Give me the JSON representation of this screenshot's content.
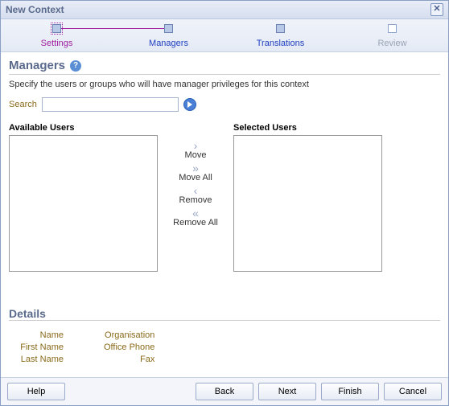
{
  "dialog": {
    "title": "New Context"
  },
  "steps": [
    {
      "label": "Settings",
      "state": "done"
    },
    {
      "label": "Managers",
      "state": "current"
    },
    {
      "label": "Translations",
      "state": "link"
    },
    {
      "label": "Review",
      "state": "disabled"
    }
  ],
  "section": {
    "title": "Managers",
    "description": "Specify the users or groups who will have manager privileges for this context"
  },
  "search": {
    "label": "Search",
    "value": ""
  },
  "picker": {
    "available_label": "Available Users",
    "selected_label": "Selected Users",
    "move": "Move",
    "move_all": "Move All",
    "remove": "Remove",
    "remove_all": "Remove All"
  },
  "details": {
    "title": "Details",
    "left": [
      "Name",
      "First Name",
      "Last Name"
    ],
    "right": [
      "Organisation",
      "Office Phone",
      "Fax"
    ]
  },
  "footer": {
    "help": "Help",
    "back": "Back",
    "next": "Next",
    "finish": "Finish",
    "cancel": "Cancel"
  }
}
